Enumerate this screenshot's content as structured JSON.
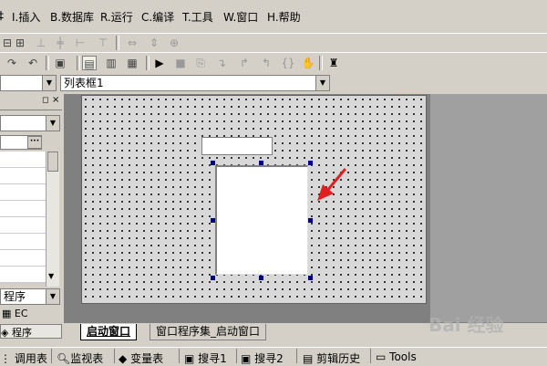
{
  "menu": [
    {
      "label": "I.插入",
      "u": "I"
    },
    {
      "label": "B.数据库",
      "u": "B"
    },
    {
      "label": "R.运行",
      "u": "R"
    },
    {
      "label": "C.编译",
      "u": "C"
    },
    {
      "label": "T.工具",
      "u": "T"
    },
    {
      "label": "W.窗口",
      "u": "W"
    },
    {
      "label": "H.帮助",
      "u": "H"
    }
  ],
  "combo": {
    "value": "列表框1"
  },
  "left_panel": {
    "dropdown_text": "程序",
    "tree_items": [
      "EC",
      "程序"
    ]
  },
  "tabs": {
    "active": "启动窗口",
    "second": "窗口程序集_启动窗口"
  },
  "bottom_tabs": [
    "调用表",
    "监视表",
    "变量表",
    "搜寻1",
    "搜寻2",
    "剪辑历史",
    "Tools"
  ],
  "watermark": "Bai 经验",
  "colors": {
    "handle": "#000080",
    "arrow": "#e02020"
  }
}
